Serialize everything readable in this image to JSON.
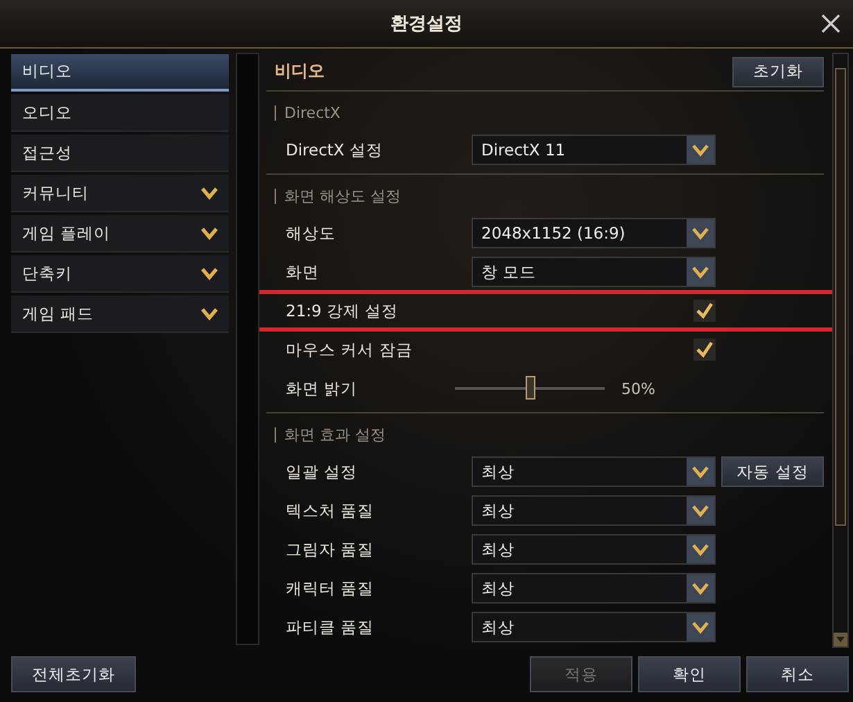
{
  "window": {
    "title": "환경설정"
  },
  "sidebar": {
    "items": [
      {
        "label": "비디오",
        "expandable": false,
        "selected": true
      },
      {
        "label": "오디오",
        "expandable": false,
        "selected": false
      },
      {
        "label": "접근성",
        "expandable": false,
        "selected": false
      },
      {
        "label": "커뮤니티",
        "expandable": true,
        "selected": false
      },
      {
        "label": "게임 플레이",
        "expandable": true,
        "selected": false
      },
      {
        "label": "단축키",
        "expandable": true,
        "selected": false
      },
      {
        "label": "게임 패드",
        "expandable": true,
        "selected": false
      }
    ]
  },
  "content": {
    "heading": "비디오",
    "reset_button": "초기화",
    "sections": [
      {
        "title": "DirectX",
        "rows": [
          {
            "kind": "select",
            "label": "DirectX 설정",
            "value": "DirectX 11"
          }
        ]
      },
      {
        "title": "화면 해상도 설정",
        "rows": [
          {
            "kind": "select",
            "label": "해상도",
            "value": "2048x1152 (16:9)"
          },
          {
            "kind": "select",
            "label": "화면",
            "value": "창 모드"
          },
          {
            "kind": "checkbox",
            "label": "21:9 강제 설정",
            "checked": true,
            "highlighted": true
          },
          {
            "kind": "checkbox",
            "label": "마우스 커서 잠금",
            "checked": true,
            "highlighted": false
          },
          {
            "kind": "slider",
            "label": "화면 밝기",
            "level": 0.5,
            "reading": "50%"
          }
        ]
      },
      {
        "title": "화면 효과 설정",
        "rows": [
          {
            "kind": "select",
            "label": "일괄 설정",
            "value": "최상",
            "button": "자동 설정"
          },
          {
            "kind": "select",
            "label": "텍스처 품질",
            "value": "최상"
          },
          {
            "kind": "select",
            "label": "그림자 품질",
            "value": "최상"
          },
          {
            "kind": "select",
            "label": "캐릭터 품질",
            "value": "최상"
          },
          {
            "kind": "select",
            "label": "파티클 품질",
            "value": "최상"
          }
        ]
      }
    ]
  },
  "footer": {
    "reset_all": "전체초기화",
    "buttons": [
      {
        "label": "적용",
        "disabled": true
      },
      {
        "label": "확인",
        "disabled": false
      },
      {
        "label": "취소",
        "disabled": false
      }
    ]
  }
}
